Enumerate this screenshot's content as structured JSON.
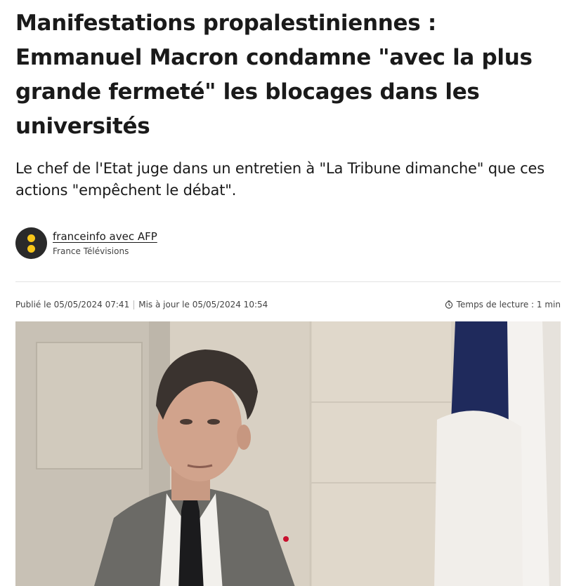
{
  "article": {
    "headline": "Manifestations propalestiniennes : Emmanuel Macron condamne \"avec la plus grande fermeté\" les blocages dans les universités",
    "chapo": "Le chef de l'Etat juge dans un entretien à \"La Tribune dimanche\" que ces actions \"empêchent le débat\".",
    "author": {
      "name": "franceinfo avec AFP",
      "organization": "France Télévisions"
    },
    "meta": {
      "published": "Publié le 05/05/2024 07:41",
      "updated": "Mis à jour le 05/05/2024 10:54",
      "reading_time": "Temps de lecture : 1 min"
    }
  },
  "colors": {
    "text": "#1a1a1a",
    "avatar_bg": "#2a2a2a",
    "avatar_dots": "#f7c61a",
    "flag_blue": "#1f2a5c",
    "flag_white": "#f4f2ef"
  },
  "icons": {
    "avatar": "franceinfo-logo",
    "reading_time": "clock-icon"
  }
}
